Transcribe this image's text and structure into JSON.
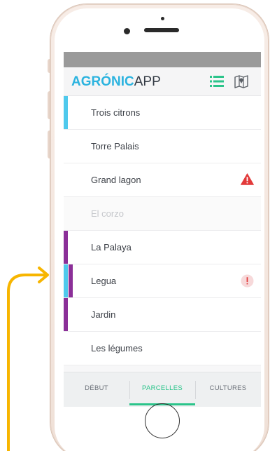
{
  "header": {
    "logo_bold": "AGRÓNIC",
    "logo_light": "APP"
  },
  "icons": {
    "list_view": "list-icon",
    "map_view": "map-icon",
    "alert_triangle": "warning-triangle-icon",
    "alert_circle": "exclamation-circle-icon"
  },
  "colors": {
    "accent_blue": "#2bb3df",
    "accent_green": "#2bc48a",
    "marker_cyan": "#4fc9ec",
    "marker_purple": "#8b2f98",
    "alert_red": "#e23a3a",
    "pointer_yellow": "#f7b500"
  },
  "parcels": [
    {
      "label": "Trois citrons",
      "markers": [
        "cyan"
      ],
      "alert": null,
      "enabled": true
    },
    {
      "label": "Torre Palais",
      "markers": [],
      "alert": null,
      "enabled": true
    },
    {
      "label": "Grand lagon",
      "markers": [],
      "alert": "triangle",
      "enabled": true
    },
    {
      "label": "El corzo",
      "markers": [],
      "alert": null,
      "enabled": false
    },
    {
      "label": "La Palaya",
      "markers": [
        "purple"
      ],
      "alert": null,
      "enabled": true
    },
    {
      "label": "Legua",
      "markers": [
        "cyan",
        "purple"
      ],
      "alert": "circle",
      "enabled": true
    },
    {
      "label": "Jardin",
      "markers": [
        "purple"
      ],
      "alert": null,
      "enabled": true
    },
    {
      "label": "Les légumes",
      "markers": [],
      "alert": null,
      "enabled": true
    }
  ],
  "tabs": [
    {
      "label": "DÉBUT",
      "active": false
    },
    {
      "label": "PARCELLES",
      "active": true
    },
    {
      "label": "CULTURES",
      "active": false
    }
  ]
}
